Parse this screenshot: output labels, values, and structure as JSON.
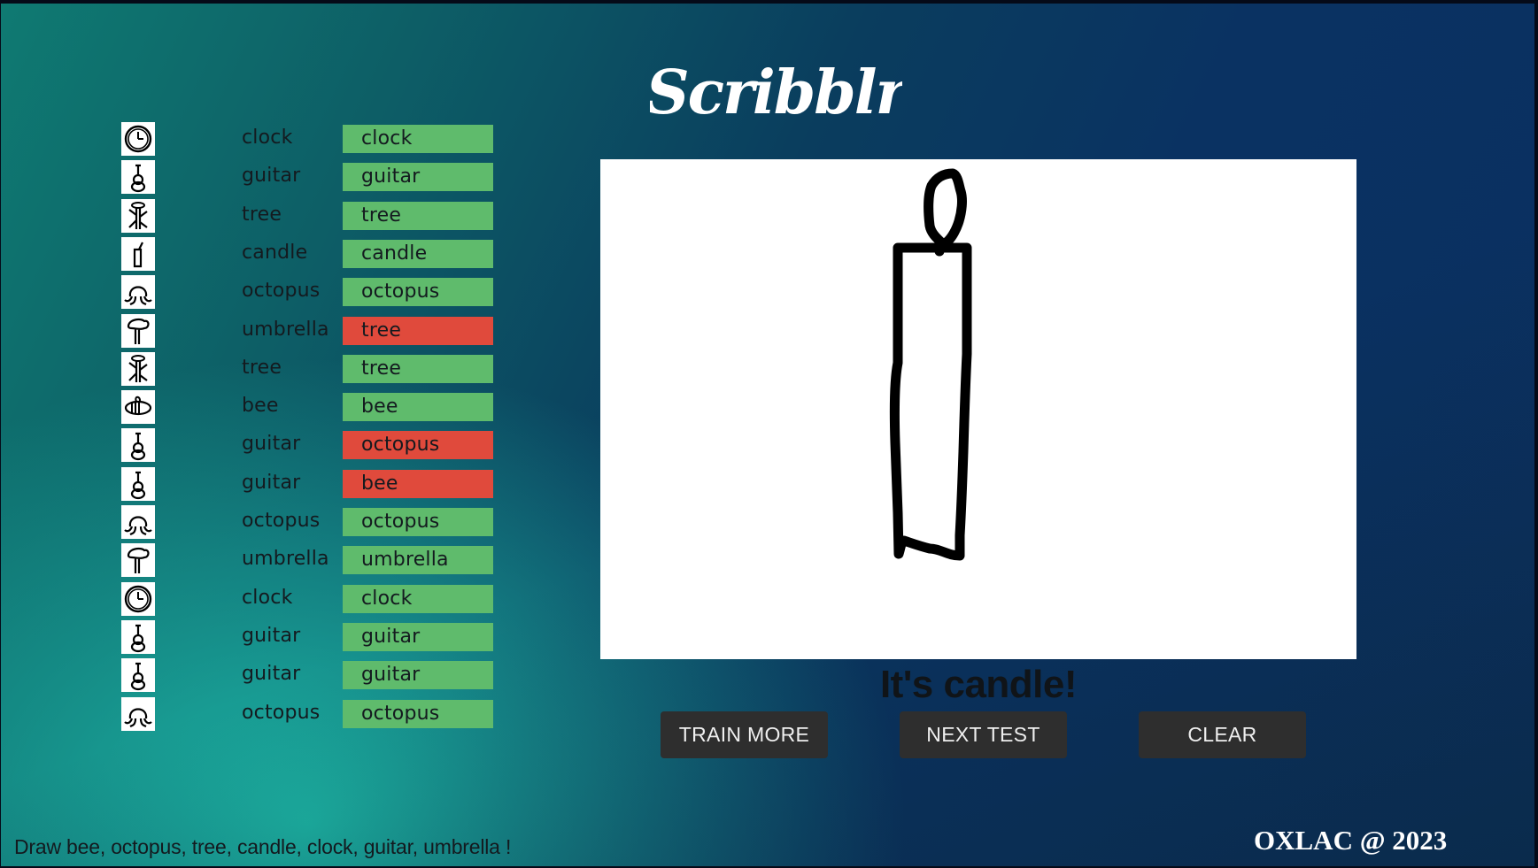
{
  "app": {
    "title": "Scribblr",
    "copyright": "OXLAC @ 2023",
    "instructions": "Draw bee, octopus, tree, candle, clock, guitar, umbrella !"
  },
  "colors": {
    "correct": "#5fbb6c",
    "incorrect": "#e04a3c",
    "button_bg": "#2e2e2e",
    "button_text": "#efefef",
    "canvas_bg": "#ffffff"
  },
  "results": [
    {
      "icon": "clock-sketch-icon",
      "truth": "clock",
      "prediction": "clock",
      "correct": true
    },
    {
      "icon": "guitar-sketch-icon",
      "truth": "guitar",
      "prediction": "guitar",
      "correct": true
    },
    {
      "icon": "tree-sketch-icon",
      "truth": "tree",
      "prediction": "tree",
      "correct": true
    },
    {
      "icon": "candle-sketch-icon",
      "truth": "candle",
      "prediction": "candle",
      "correct": true
    },
    {
      "icon": "octopus-sketch-icon",
      "truth": "octopus",
      "prediction": "octopus",
      "correct": true
    },
    {
      "icon": "umbrella-sketch-icon",
      "truth": "umbrella",
      "prediction": "tree",
      "correct": false
    },
    {
      "icon": "tree-sketch-icon",
      "truth": "tree",
      "prediction": "tree",
      "correct": true
    },
    {
      "icon": "bee-sketch-icon",
      "truth": "bee",
      "prediction": "bee",
      "correct": true
    },
    {
      "icon": "guitar-sketch-icon",
      "truth": "guitar",
      "prediction": "octopus",
      "correct": false
    },
    {
      "icon": "guitar-sketch-icon",
      "truth": "guitar",
      "prediction": "bee",
      "correct": false
    },
    {
      "icon": "octopus-sketch-icon",
      "truth": "octopus",
      "prediction": "octopus",
      "correct": true
    },
    {
      "icon": "umbrella-sketch-icon",
      "truth": "umbrella",
      "prediction": "umbrella",
      "correct": true
    },
    {
      "icon": "clock-sketch-icon",
      "truth": "clock",
      "prediction": "clock",
      "correct": true
    },
    {
      "icon": "guitar-sketch-icon",
      "truth": "guitar",
      "prediction": "guitar",
      "correct": true
    },
    {
      "icon": "guitar-sketch-icon",
      "truth": "guitar",
      "prediction": "guitar",
      "correct": true
    },
    {
      "icon": "octopus-sketch-icon",
      "truth": "octopus",
      "prediction": "octopus",
      "correct": true
    }
  ],
  "canvas": {
    "drawing": "candle"
  },
  "prediction_text": "It's candle!",
  "buttons": {
    "train_more": "TRAIN MORE",
    "next_test": "NEXT TEST",
    "clear": "CLEAR"
  }
}
